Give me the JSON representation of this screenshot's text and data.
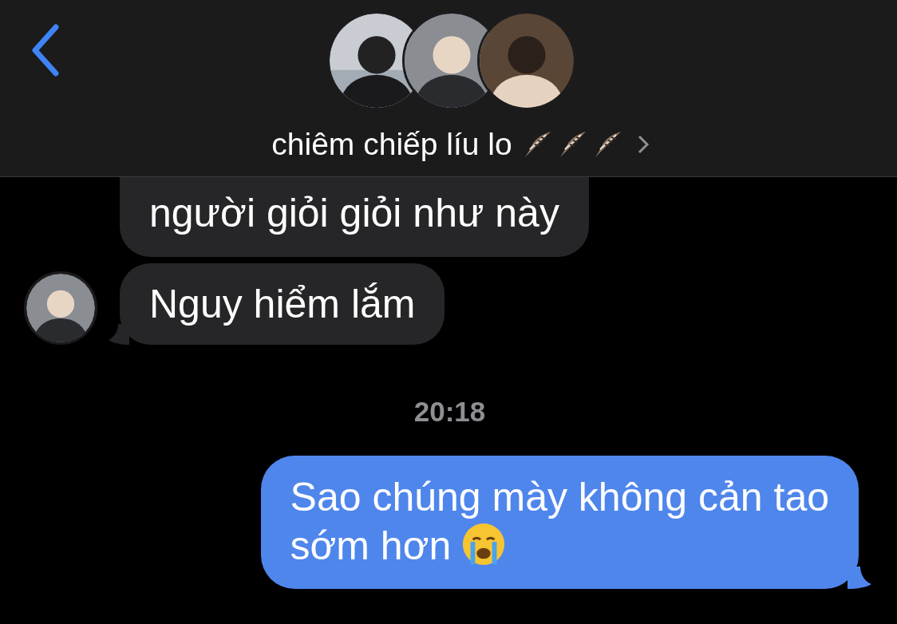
{
  "header": {
    "title": "chiêm chiếp líu lo"
  },
  "messages": [
    {
      "kind": "incoming",
      "lines": [
        "người giỏi giỏi như này"
      ],
      "avatar": false,
      "tail": false
    },
    {
      "kind": "incoming",
      "lines": [
        "Nguy hiểm lắm"
      ],
      "avatar": true,
      "tail": true
    },
    {
      "kind": "timestamp",
      "text": "20:18"
    },
    {
      "kind": "outgoing",
      "lines": [
        "Sao chúng mày không cản tao",
        "sớm hơn"
      ],
      "tail": true
    }
  ]
}
